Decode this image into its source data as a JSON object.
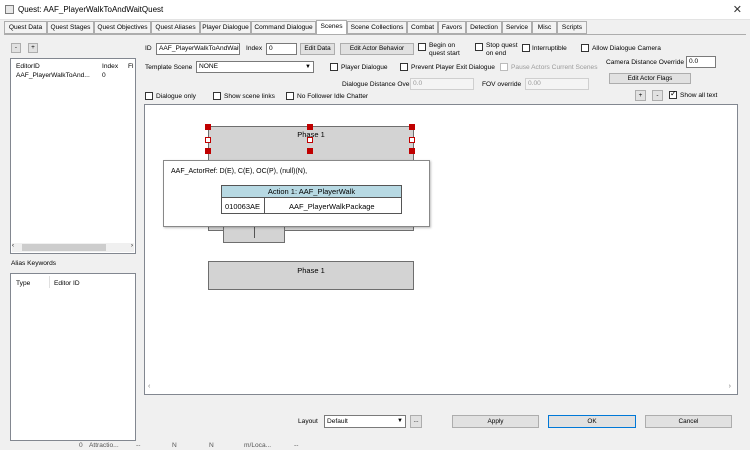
{
  "window": {
    "title": "Quest: AAF_PlayerWalkToAndWaitQuest"
  },
  "tabs": [
    "Quest Data",
    "Quest Stages",
    "Quest Objectives",
    "Quest Aliases",
    "Player Dialogue",
    "Command Dialogue",
    "Scenes",
    "Scene Collections",
    "Combat",
    "Favors",
    "Detection",
    "Service",
    "Misc",
    "Scripts"
  ],
  "active_tab": "Scenes",
  "left": {
    "add": "+",
    "remove": "-",
    "scene_list": {
      "columns": [
        "EditorID",
        "Index",
        "Fl"
      ],
      "rows": [
        [
          "AAF_PlayerWalkToAnd...",
          "0",
          ""
        ]
      ]
    },
    "alias_title": "Alias Keywords",
    "alias_list": {
      "columns": [
        "Type",
        "Editor ID"
      ]
    }
  },
  "scene": {
    "id_label": "ID",
    "id_value": "AAF_PlayerWalkToAndWait",
    "index_label": "Index",
    "index_value": "0",
    "edit_data": "Edit Data",
    "edit_actor_behavior": "Edit Actor Behavior",
    "begin_on_quest_start": "Begin on quest start",
    "stop_quest_on_end": "Stop quest on end",
    "interruptible": "Interruptible",
    "allow_dialogue_camera": "Allow Dialogue Camera",
    "camera_distance_override_label": "Camera Distance Override",
    "camera_distance_override_value": "0.0",
    "template_scene_label": "Template Scene",
    "template_scene_value": "NONE",
    "player_dialogue": "Player Dialogue",
    "prevent_player_exit_dialogue": "Prevent Player Exit Dialogue",
    "pause_actors_current_scenes": "Pause Actors Current Scenes",
    "edit_actor_flags": "Edit Actor Flags",
    "dialogue_distance_override_label": "Dialogue Distance Override",
    "dialogue_distance_override_value": "0.0",
    "fov_override_label": "FOV override",
    "fov_override_value": "0.00",
    "dialogue_only": "Dialogue only",
    "show_scene_links": "Show scene links",
    "no_follower_idle_chatter": "No Follower Idle Chatter",
    "plus": "+",
    "minus": "-",
    "show_all_text": "Show all text"
  },
  "canvas": {
    "phase_top": "Phase 1",
    "phase_bottom": "Phase 1",
    "actor_ref": "AAF_ActorRef: D(E), C(E), OC(P), (null)(N),",
    "action_header": "Action 1: AAF_PlayerWalk",
    "action_id": "010063AE",
    "action_package": "AAF_PlayerWalkPackage"
  },
  "bottom": {
    "layout_label": "Layout",
    "layout_value": "Default",
    "ellipsis": "...",
    "apply": "Apply",
    "ok": "OK",
    "cancel": "Cancel"
  },
  "background_row": [
    "0",
    "Attractio...",
    "--",
    "N",
    "N",
    "m/Loca...",
    "--"
  ],
  "colors": {
    "action_header": "#b7d9e3",
    "handle": "#c00000",
    "node": "#d3d3d3"
  }
}
